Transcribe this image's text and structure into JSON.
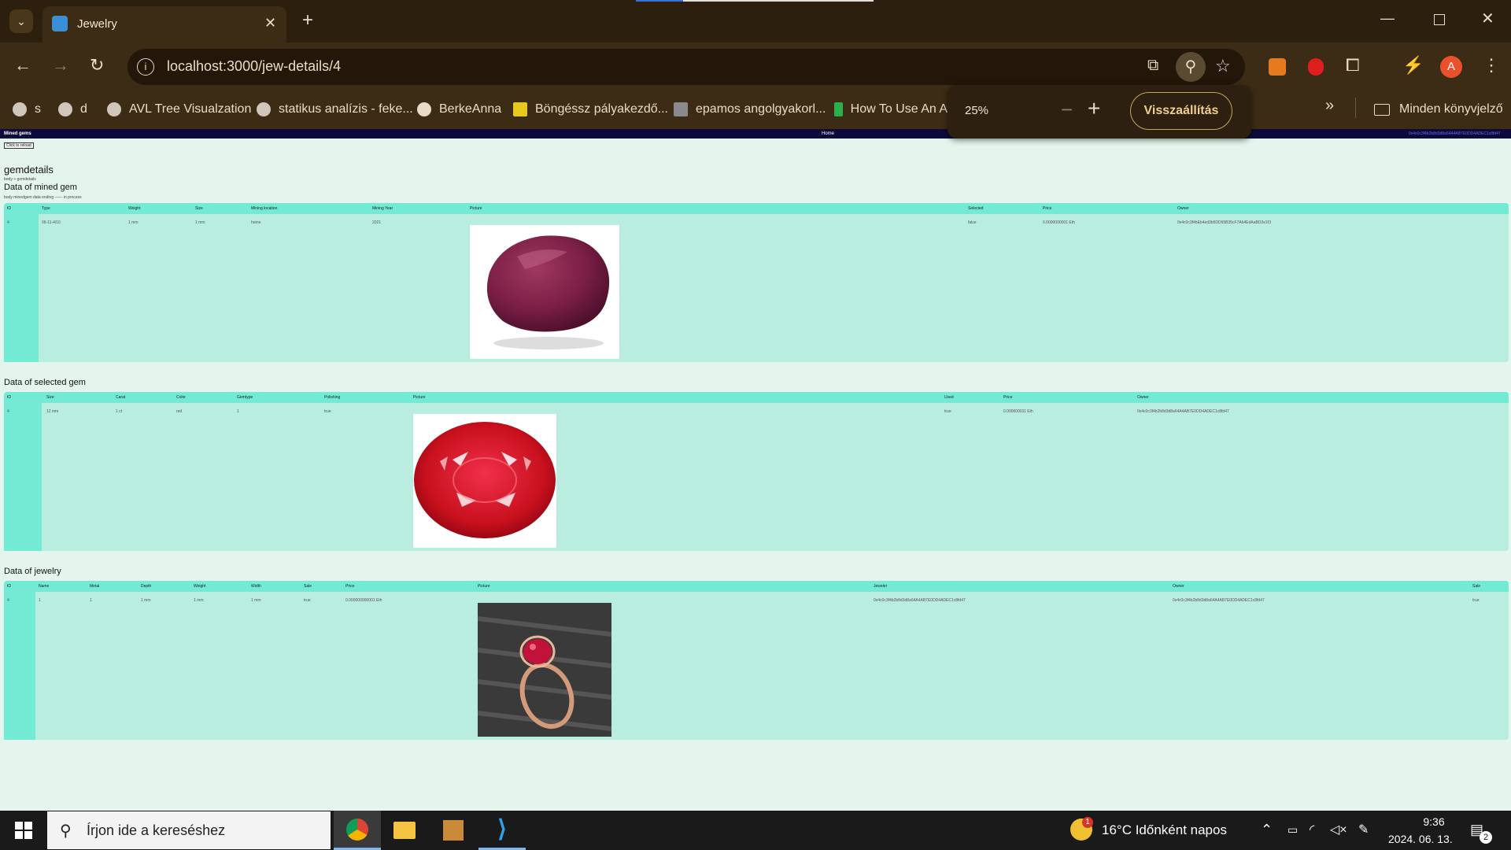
{
  "browser": {
    "tab_title": "Jewelry",
    "url": "localhost:3000/jew-details/4",
    "bookmarks": [
      "s",
      "d",
      "AVL Tree Visualzation",
      "statikus analízis - feke...",
      "BerkeAnna",
      "Böngéssz pályakezdő...",
      "epamos angolgyakorl...",
      "How To Use An A"
    ],
    "bookmarks_folder": "Minden könyvjelző",
    "profile_initial": "A",
    "zoom": {
      "level": "25%",
      "reset_label": "Visszaállítás"
    }
  },
  "app": {
    "nav_brand": "Mined gems",
    "nav_home": "Home",
    "nav_account": "0x4c0c3f4b2b8d3d8a64A4AB7E0DD4ADEC1c8fd47",
    "back_button": "Click to reload",
    "page_title": "gemdetails",
    "breadcrumb": "body > gemdetails",
    "section1": {
      "title": "Data of mined gem",
      "subtitle": "body minedgem data ending —— in process",
      "columns": [
        "ID",
        "Type",
        "Weight",
        "Size",
        "Mining location",
        "Mining Year",
        "Picture",
        "Selected",
        "Price",
        "Owner"
      ],
      "row": [
        "4",
        "06-11-4/10",
        "1 mm",
        "1 mm",
        "home",
        "2021",
        "",
        "false",
        "0.0000000001 Eth",
        "0x4c0c3f4bEb4ed3b5DD65B35cF7Ab4EdAaBD2e1f3"
      ]
    },
    "section2": {
      "title": "Data of selected gem",
      "columns": [
        "ID",
        "Size",
        "Carat",
        "Color",
        "Gemtype",
        "Polishing",
        "Picture",
        "Used",
        "Price",
        "Owner"
      ],
      "row": [
        "4",
        "12 mm",
        "1 ct",
        "red",
        "1",
        "true",
        "",
        "true",
        "0.000000011 Eth",
        "0x4c0c3f4b2b8d3d8a64A4AB7E0DD4ADEC1c8fd47"
      ]
    },
    "section3": {
      "title": "Data of jewelry",
      "columns": [
        "ID",
        "Name",
        "Metal",
        "Depth",
        "Weight",
        "Width",
        "Sale",
        "Price",
        "Picture",
        "Jeweler",
        "Owner",
        "Sale"
      ],
      "row": [
        "4",
        "1",
        "1",
        "1 mm",
        "1 mm",
        "1 mm",
        "true",
        "0.000000000001 Eth",
        "",
        "0x4c0c3f4b2b8d3d8a64A4AB7E0DD4ADEC1c8fd47",
        "0x4c0c3f4b2b8d3d8a64A4AB7E0DD4ADEC1c8fd47",
        "true"
      ]
    }
  },
  "taskbar": {
    "search_placeholder": "Írjon ide a kereséshez",
    "weather_badge": "1",
    "weather": "16°C  Időnként napos",
    "time": "9:36",
    "date": "2024. 06. 13.",
    "notif_count": "2"
  },
  "colors": {
    "nav": "#0d0a3b",
    "thead": "#73ead4",
    "tbody": "#b8ede0",
    "page": "#e4f5ee"
  }
}
